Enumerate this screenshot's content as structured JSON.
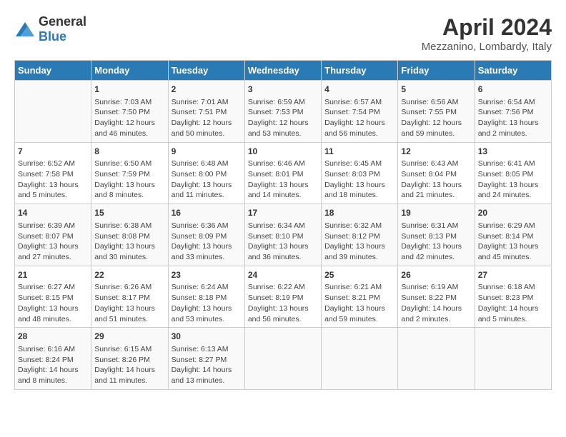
{
  "logo": {
    "general": "General",
    "blue": "Blue"
  },
  "title": "April 2024",
  "subtitle": "Mezzanino, Lombardy, Italy",
  "days_header": [
    "Sunday",
    "Monday",
    "Tuesday",
    "Wednesday",
    "Thursday",
    "Friday",
    "Saturday"
  ],
  "weeks": [
    [
      {
        "day": "",
        "info": ""
      },
      {
        "day": "1",
        "info": "Sunrise: 7:03 AM\nSunset: 7:50 PM\nDaylight: 12 hours\nand 46 minutes."
      },
      {
        "day": "2",
        "info": "Sunrise: 7:01 AM\nSunset: 7:51 PM\nDaylight: 12 hours\nand 50 minutes."
      },
      {
        "day": "3",
        "info": "Sunrise: 6:59 AM\nSunset: 7:53 PM\nDaylight: 12 hours\nand 53 minutes."
      },
      {
        "day": "4",
        "info": "Sunrise: 6:57 AM\nSunset: 7:54 PM\nDaylight: 12 hours\nand 56 minutes."
      },
      {
        "day": "5",
        "info": "Sunrise: 6:56 AM\nSunset: 7:55 PM\nDaylight: 12 hours\nand 59 minutes."
      },
      {
        "day": "6",
        "info": "Sunrise: 6:54 AM\nSunset: 7:56 PM\nDaylight: 13 hours\nand 2 minutes."
      }
    ],
    [
      {
        "day": "7",
        "info": "Sunrise: 6:52 AM\nSunset: 7:58 PM\nDaylight: 13 hours\nand 5 minutes."
      },
      {
        "day": "8",
        "info": "Sunrise: 6:50 AM\nSunset: 7:59 PM\nDaylight: 13 hours\nand 8 minutes."
      },
      {
        "day": "9",
        "info": "Sunrise: 6:48 AM\nSunset: 8:00 PM\nDaylight: 13 hours\nand 11 minutes."
      },
      {
        "day": "10",
        "info": "Sunrise: 6:46 AM\nSunset: 8:01 PM\nDaylight: 13 hours\nand 14 minutes."
      },
      {
        "day": "11",
        "info": "Sunrise: 6:45 AM\nSunset: 8:03 PM\nDaylight: 13 hours\nand 18 minutes."
      },
      {
        "day": "12",
        "info": "Sunrise: 6:43 AM\nSunset: 8:04 PM\nDaylight: 13 hours\nand 21 minutes."
      },
      {
        "day": "13",
        "info": "Sunrise: 6:41 AM\nSunset: 8:05 PM\nDaylight: 13 hours\nand 24 minutes."
      }
    ],
    [
      {
        "day": "14",
        "info": "Sunrise: 6:39 AM\nSunset: 8:07 PM\nDaylight: 13 hours\nand 27 minutes."
      },
      {
        "day": "15",
        "info": "Sunrise: 6:38 AM\nSunset: 8:08 PM\nDaylight: 13 hours\nand 30 minutes."
      },
      {
        "day": "16",
        "info": "Sunrise: 6:36 AM\nSunset: 8:09 PM\nDaylight: 13 hours\nand 33 minutes."
      },
      {
        "day": "17",
        "info": "Sunrise: 6:34 AM\nSunset: 8:10 PM\nDaylight: 13 hours\nand 36 minutes."
      },
      {
        "day": "18",
        "info": "Sunrise: 6:32 AM\nSunset: 8:12 PM\nDaylight: 13 hours\nand 39 minutes."
      },
      {
        "day": "19",
        "info": "Sunrise: 6:31 AM\nSunset: 8:13 PM\nDaylight: 13 hours\nand 42 minutes."
      },
      {
        "day": "20",
        "info": "Sunrise: 6:29 AM\nSunset: 8:14 PM\nDaylight: 13 hours\nand 45 minutes."
      }
    ],
    [
      {
        "day": "21",
        "info": "Sunrise: 6:27 AM\nSunset: 8:15 PM\nDaylight: 13 hours\nand 48 minutes."
      },
      {
        "day": "22",
        "info": "Sunrise: 6:26 AM\nSunset: 8:17 PM\nDaylight: 13 hours\nand 51 minutes."
      },
      {
        "day": "23",
        "info": "Sunrise: 6:24 AM\nSunset: 8:18 PM\nDaylight: 13 hours\nand 53 minutes."
      },
      {
        "day": "24",
        "info": "Sunrise: 6:22 AM\nSunset: 8:19 PM\nDaylight: 13 hours\nand 56 minutes."
      },
      {
        "day": "25",
        "info": "Sunrise: 6:21 AM\nSunset: 8:21 PM\nDaylight: 13 hours\nand 59 minutes."
      },
      {
        "day": "26",
        "info": "Sunrise: 6:19 AM\nSunset: 8:22 PM\nDaylight: 14 hours\nand 2 minutes."
      },
      {
        "day": "27",
        "info": "Sunrise: 6:18 AM\nSunset: 8:23 PM\nDaylight: 14 hours\nand 5 minutes."
      }
    ],
    [
      {
        "day": "28",
        "info": "Sunrise: 6:16 AM\nSunset: 8:24 PM\nDaylight: 14 hours\nand 8 minutes."
      },
      {
        "day": "29",
        "info": "Sunrise: 6:15 AM\nSunset: 8:26 PM\nDaylight: 14 hours\nand 11 minutes."
      },
      {
        "day": "30",
        "info": "Sunrise: 6:13 AM\nSunset: 8:27 PM\nDaylight: 14 hours\nand 13 minutes."
      },
      {
        "day": "",
        "info": ""
      },
      {
        "day": "",
        "info": ""
      },
      {
        "day": "",
        "info": ""
      },
      {
        "day": "",
        "info": ""
      }
    ]
  ]
}
